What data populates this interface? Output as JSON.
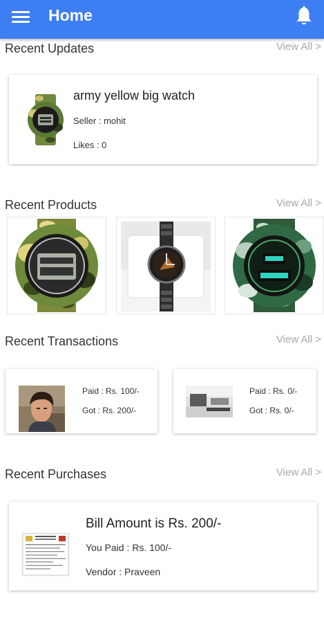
{
  "app_bar": {
    "title": "Home",
    "menu_icon": "menu-icon",
    "bell_icon": "notifications-bell-icon",
    "color": "#3d7ef2"
  },
  "recent_updates": {
    "title": "Recent Updates",
    "view_all": "View All >",
    "item": {
      "name": "army yellow big watch",
      "seller": "Seller : mohit",
      "likes": "Likes : 0"
    }
  },
  "recent_products": {
    "title": "Recent Products",
    "view_all": "View All >"
  },
  "recent_transactions": {
    "title": "Recent Transactions",
    "view_all": "View All >",
    "items": [
      {
        "paid": "Paid : Rs. 100/-",
        "got": "Got : Rs. 200/-"
      },
      {
        "paid": "Paid : Rs. 0/-",
        "got": "Got : Rs. 0/-"
      }
    ]
  },
  "recent_purchases": {
    "title": "Recent Purchases",
    "view_all": "View All >",
    "item": {
      "bill": "Bill Amount is Rs. 200/-",
      "paid": "You Paid : Rs. 100/-",
      "vendor": "Vendor : Praveen"
    }
  }
}
